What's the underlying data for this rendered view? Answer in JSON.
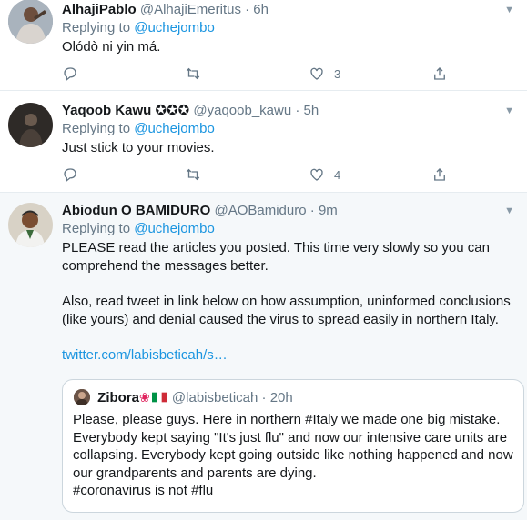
{
  "tweets": [
    {
      "name": "AlhajiPablo",
      "handle": "@AlhajiEmeritus",
      "separator": "·",
      "time": "6h",
      "replying_label": "Replying to",
      "replying_to": "@uchejombo",
      "text": "Olódò ni yin má.",
      "reply_count": "",
      "retweet_count": "",
      "like_count": "3"
    },
    {
      "name": "Yaqoob Kawu ✪✪✪",
      "handle": "@yaqoob_kawu",
      "separator": "·",
      "time": "5h",
      "replying_label": "Replying to",
      "replying_to": "@uchejombo",
      "text": "Just stick to your movies.",
      "reply_count": "",
      "retweet_count": "",
      "like_count": "4"
    },
    {
      "name": "Abiodun O BAMIDURO",
      "handle": "@AOBamiduro",
      "separator": "·",
      "time": "9m",
      "replying_label": "Replying to",
      "replying_to": "@uchejombo",
      "text_p1": "PLEASE read the articles you posted. This time very slowly so you can comprehend the messages better.",
      "text_p2": "Also, read tweet in link below on how assumption, uninformed conclusions (like yours) and denial caused the virus to spread easily in northern Italy.",
      "link": "twitter.com/labisbeticah/s…"
    }
  ],
  "quote": {
    "name": "Zibora",
    "handle": "@labisbeticah",
    "separator": "·",
    "time": "20h",
    "text": "Please, please guys. Here in northern #Italy we made one big mistake. Everybody kept saying \"It's just flu\" and now our intensive care units are collapsing. Everybody kept going outside like nothing happened and now our grandparents and parents are dying.\n#coronavirus is not #flu"
  },
  "colors": {
    "link": "#1b95e0",
    "muted": "#657786",
    "border": "#e6ecf0",
    "highlight_bg": "#f5f8fa"
  },
  "icons": {
    "reply": "reply-icon",
    "retweet": "retweet-icon",
    "like": "heart-icon",
    "share": "share-icon",
    "caret": "chevron-down-icon"
  }
}
